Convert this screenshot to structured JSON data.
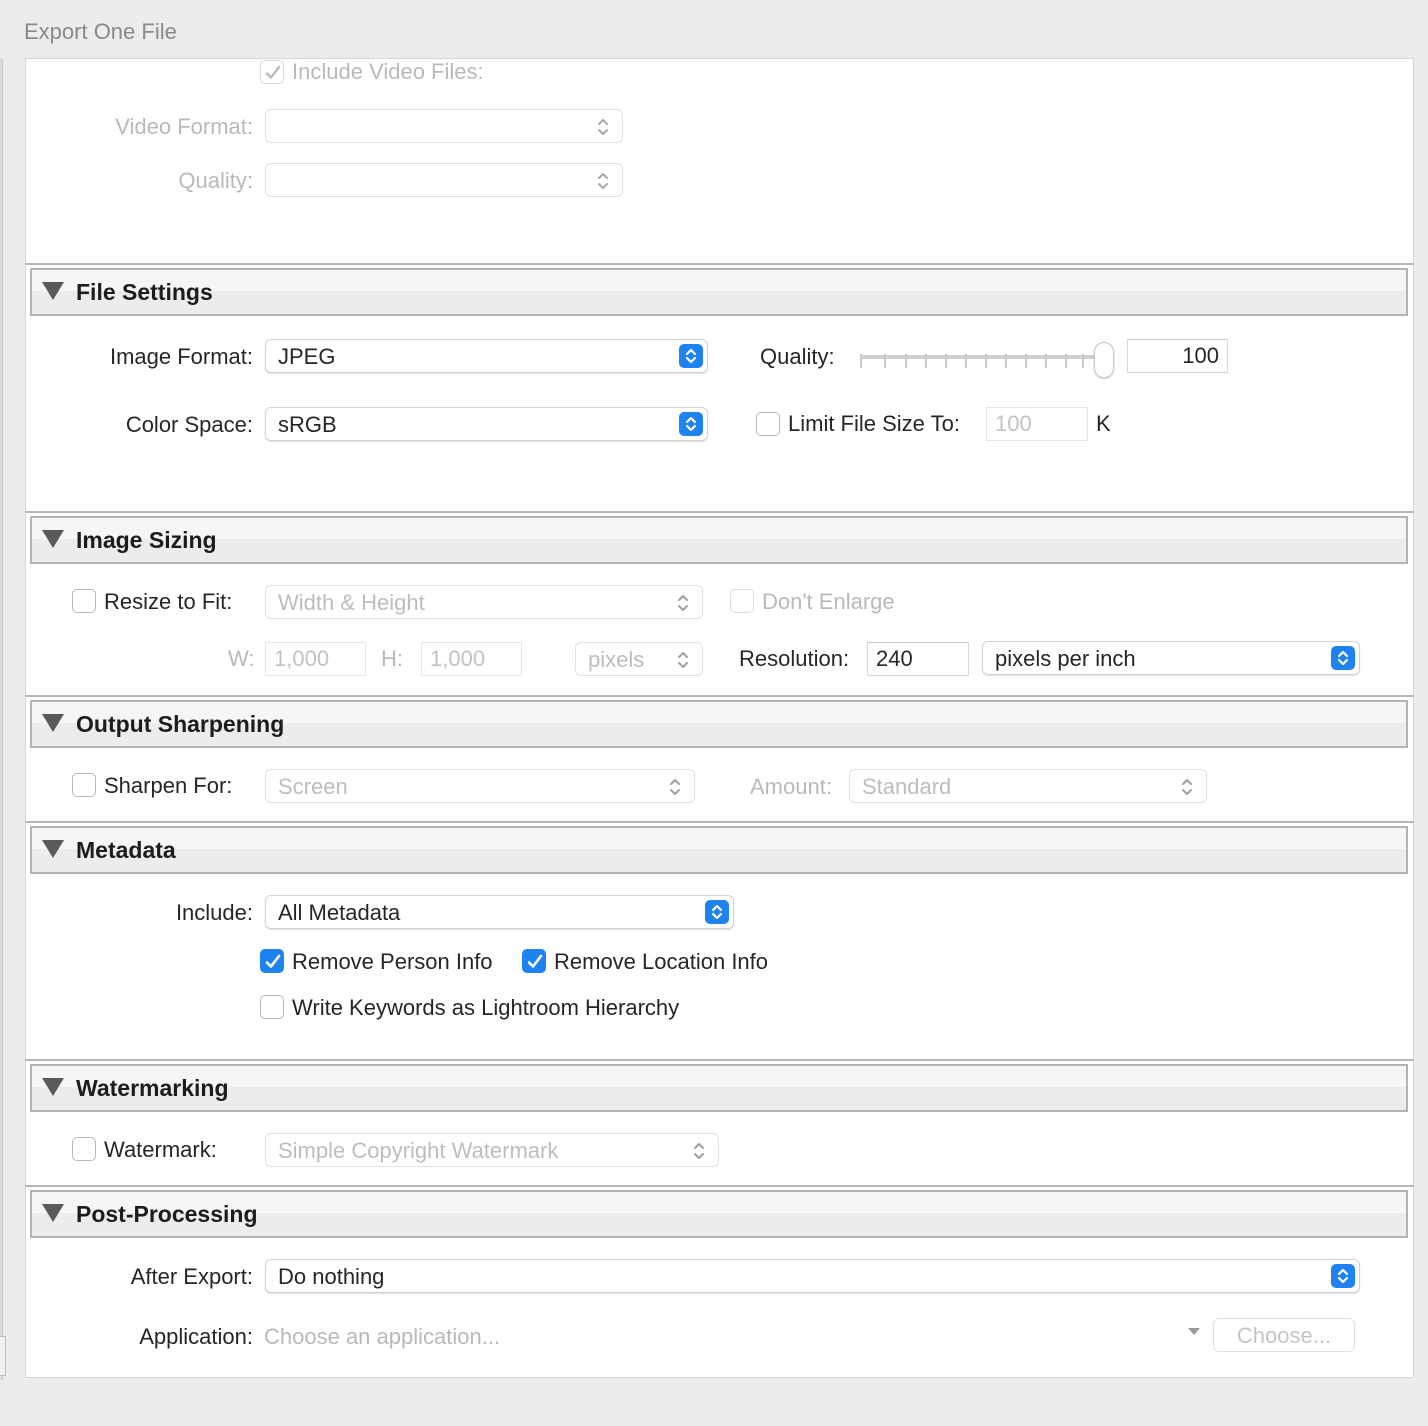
{
  "window": {
    "title": "Export One File"
  },
  "video": {
    "include_label": "Include Video Files:",
    "include_checked": true,
    "format_label": "Video Format:",
    "format_value": "",
    "quality_label": "Quality:",
    "quality_value": ""
  },
  "sections": {
    "file_settings": "File Settings",
    "image_sizing": "Image Sizing",
    "output_sharpening": "Output Sharpening",
    "metadata": "Metadata",
    "watermarking": "Watermarking",
    "post_processing": "Post-Processing"
  },
  "file_settings": {
    "image_format_label": "Image Format:",
    "image_format_value": "JPEG",
    "color_space_label": "Color Space:",
    "color_space_value": "sRGB",
    "quality_label": "Quality:",
    "quality_value": "100",
    "quality_level": 100,
    "limit_size_label": "Limit File Size To:",
    "limit_size_value": "100",
    "limit_size_unit": "K",
    "limit_size_checked": false
  },
  "image_sizing": {
    "resize_label": "Resize to Fit:",
    "resize_checked": false,
    "resize_mode": "Width & Height",
    "dont_enlarge_label": "Don't Enlarge",
    "w_label": "W:",
    "w_value": "1,000",
    "h_label": "H:",
    "h_value": "1,000",
    "units_value": "pixels",
    "resolution_label": "Resolution:",
    "resolution_value": "240",
    "resolution_unit": "pixels per inch"
  },
  "output_sharpening": {
    "sharpen_label": "Sharpen For:",
    "sharpen_checked": false,
    "sharpen_value": "Screen",
    "amount_label": "Amount:",
    "amount_value": "Standard"
  },
  "metadata": {
    "include_label": "Include:",
    "include_value": "All Metadata",
    "remove_person_label": "Remove Person Info",
    "remove_person_checked": true,
    "remove_location_label": "Remove Location Info",
    "remove_location_checked": true,
    "write_keywords_label": "Write Keywords as Lightroom Hierarchy",
    "write_keywords_checked": false
  },
  "watermarking": {
    "watermark_label": "Watermark:",
    "watermark_checked": false,
    "watermark_value": "Simple Copyright Watermark"
  },
  "post_processing": {
    "after_export_label": "After Export:",
    "after_export_value": "Do nothing",
    "application_label": "Application:",
    "application_placeholder": "Choose an application...",
    "choose_button": "Choose..."
  },
  "colors": {
    "accent": "#1e82f0"
  }
}
